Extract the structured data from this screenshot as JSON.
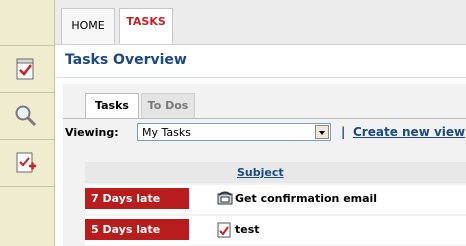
{
  "nav_tabs": [
    {
      "label": "HOME"
    },
    {
      "label": "TASKS"
    }
  ],
  "page_title": "Tasks Overview",
  "subtabs": [
    {
      "label": "Tasks"
    },
    {
      "label": "To Dos"
    }
  ],
  "viewing": {
    "label": "Viewing:",
    "selected": "My Tasks",
    "separator": "|",
    "create_link": "Create new view"
  },
  "table": {
    "columns": {
      "subject": "Subject"
    },
    "rows": [
      {
        "status": "7 Days late",
        "icon": "phone-icon",
        "subject": "Get confirmation email"
      },
      {
        "status": "5 Days late",
        "icon": "document-icon",
        "subject": "test"
      }
    ]
  },
  "colors": {
    "late": "#b81c1c",
    "accent": "#1a4a80",
    "active_tab": "#cc2222",
    "sidebar": "#efecd0"
  },
  "sidebar_icons": [
    "task-checklist-icon",
    "magnifier-icon",
    "add-task-icon"
  ]
}
